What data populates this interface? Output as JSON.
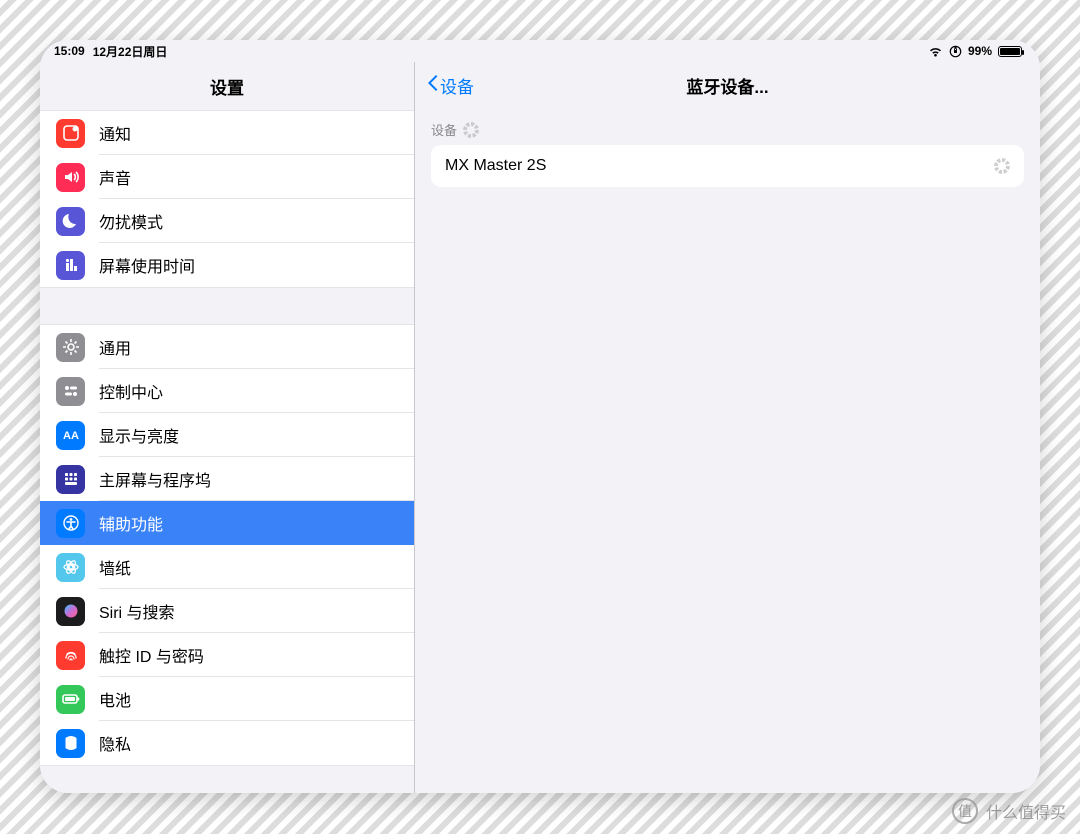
{
  "status": {
    "time": "15:09",
    "date": "12月22日周日",
    "battery_pct": "99%"
  },
  "sidebar": {
    "title": "设置",
    "groupA": [
      {
        "id": "notif",
        "label": "通知",
        "bg": "#ff3b30"
      },
      {
        "id": "sound",
        "label": "声音",
        "bg": "#ff2d55"
      },
      {
        "id": "dnd",
        "label": "勿扰模式",
        "bg": "#5856d6"
      },
      {
        "id": "screent",
        "label": "屏幕使用时间",
        "bg": "#5856d6"
      }
    ],
    "groupB": [
      {
        "id": "general",
        "label": "通用",
        "bg": "#8e8e93"
      },
      {
        "id": "cc",
        "label": "控制中心",
        "bg": "#8e8e93"
      },
      {
        "id": "display",
        "label": "显示与亮度",
        "bg": "#007aff"
      },
      {
        "id": "home",
        "label": "主屏幕与程序坞",
        "bg": "#3634a3"
      },
      {
        "id": "access",
        "label": "辅助功能",
        "bg": "#007aff",
        "selected": true
      },
      {
        "id": "wall",
        "label": "墙纸",
        "bg": "#54c7ec"
      },
      {
        "id": "siri",
        "label": "Siri 与搜索",
        "bg": "#1c1c1e"
      },
      {
        "id": "touchid",
        "label": "触控 ID 与密码",
        "bg": "#ff3b30"
      },
      {
        "id": "battery",
        "label": "电池",
        "bg": "#34c759"
      },
      {
        "id": "privacy",
        "label": "隐私",
        "bg": "#007aff"
      }
    ]
  },
  "detail": {
    "back_label": "设备",
    "title": "蓝牙设备...",
    "section_label": "设备",
    "device_name": "MX Master 2S"
  },
  "watermark": {
    "badge": "值",
    "text": "什么值得买"
  },
  "colors": {
    "accent": "#007aff",
    "select": "#3a82f7"
  }
}
